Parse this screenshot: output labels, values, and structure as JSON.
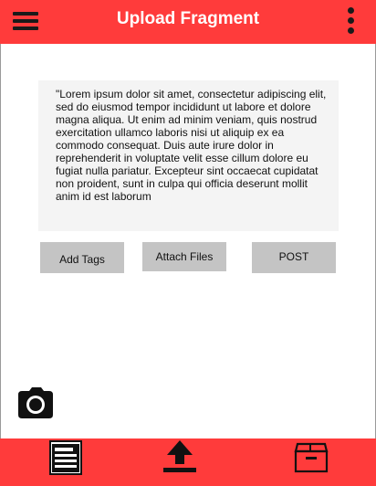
{
  "header": {
    "title": "Upload Fragment",
    "menu_icon": "hamburger-menu-icon",
    "more_icon": "more-vertical-icon"
  },
  "editor": {
    "text": "\"Lorem ipsum dolor sit amet, consectetur adipiscing elit, sed do eiusmod tempor incididunt ut labore et dolore magna aliqua. Ut enim ad minim veniam, quis nostrud exercitation ullamco laboris nisi ut aliquip ex ea commodo consequat. Duis aute irure dolor in reprehenderit in voluptate velit esse cillum dolore eu fugiat nulla pariatur. Excepteur sint occaecat cupidatat non proident, sunt in culpa qui officia deserunt mollit anim id est laborum"
  },
  "actions": {
    "add_tags": "Add Tags",
    "attach_files": "Attach Files",
    "post": "POST"
  },
  "camera_icon": "camera-icon",
  "bottom_nav": {
    "items": [
      {
        "icon": "newspaper-icon"
      },
      {
        "icon": "upload-icon"
      },
      {
        "icon": "archive-box-icon"
      }
    ]
  },
  "colors": {
    "accent": "#ff3b3b",
    "button": "#c4c4c4",
    "textbox": "#f4f4f4"
  }
}
